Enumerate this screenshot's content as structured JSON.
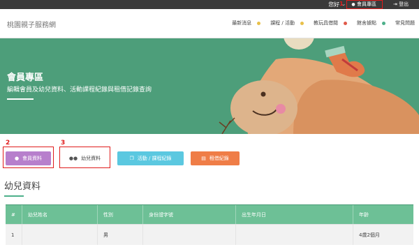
{
  "topbar": {
    "greeting": "您好 ⌣",
    "annotation": "1",
    "member_label": "會員專區",
    "logout_label": "登出"
  },
  "nav": {
    "brand": "桃園親子服務網",
    "items": [
      {
        "label": "最新消息",
        "dot": "#e8c04a"
      },
      {
        "label": "課程 / 活動",
        "dot": "#e8c04a"
      },
      {
        "label": "教玩具借閱",
        "dot": "#e05a4a"
      },
      {
        "label": "館舍據點",
        "dot": "#e05a4a"
      },
      {
        "label": "常見問題",
        "dot": "#4db08a"
      }
    ]
  },
  "hero": {
    "title": "會員專區",
    "subtitle": "編輯會員及幼兒資料、活動課程紀錄與租借記錄查詢"
  },
  "tabs": {
    "anno2": "2",
    "anno3": "3",
    "member_data": "會員資料",
    "child_data": "幼兒資料",
    "activity": "活動 / 課程紀錄",
    "rental": "租借紀錄"
  },
  "section": {
    "title": "幼兒資料"
  },
  "table": {
    "headers": [
      "#",
      "幼兒姓名",
      "性別",
      "身份證字號",
      "出生年月日",
      "年齡"
    ],
    "rows": [
      [
        "1",
        "",
        "男",
        "",
        "",
        "4歲2個月"
      ]
    ]
  },
  "colors": {
    "topbar": "#3a3a3a",
    "hero": "#4d9e7a",
    "accent_green": "#6dc096",
    "purple": "#b77fcc",
    "cyan": "#5bc8e0",
    "orange": "#ef7d47",
    "annotation_red": "#e01b1b"
  }
}
